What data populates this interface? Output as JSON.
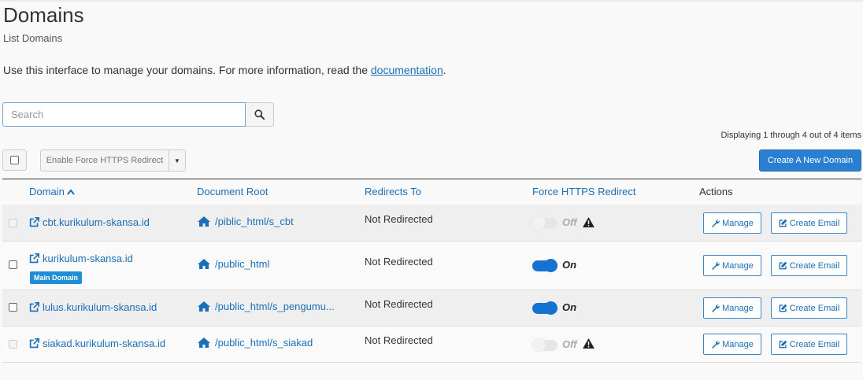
{
  "page": {
    "title": "Domains",
    "subtitle": "List Domains",
    "intro_text": "Use this interface to manage your domains. For more information, read the ",
    "intro_link": "documentation",
    "intro_end": "."
  },
  "search": {
    "placeholder": "Search",
    "value": ""
  },
  "toolbar": {
    "display_count": "Displaying 1 through 4 out of 4 items",
    "bulk_action_label": "Enable Force HTTPS Redirect",
    "create_label": "Create A New Domain"
  },
  "table": {
    "headers": {
      "domain": "Domain",
      "doc_root": "Document Root",
      "redirects": "Redirects To",
      "force_https": "Force HTTPS Redirect",
      "actions": "Actions"
    },
    "rows": [
      {
        "domain": "cbt.kurikulum-skansa.id",
        "doc_root": "/piblic_html/s_cbt",
        "redirects": "Not Redirected",
        "https_state": "Off",
        "badge": "",
        "manage": "Manage",
        "create_email": "Create Email"
      },
      {
        "domain": "kurikulum-skansa.id",
        "doc_root": "/public_html",
        "redirects": "Not Redirected",
        "https_state": "On",
        "badge": "Main Domain",
        "manage": "Manage",
        "create_email": "Create Email"
      },
      {
        "domain": "lulus.kurikulum-skansa.id",
        "doc_root": "/public_html/s_pengumu...",
        "redirects": "Not Redirected",
        "https_state": "On",
        "badge": "",
        "manage": "Manage",
        "create_email": "Create Email"
      },
      {
        "domain": "siakad.kurikulum-skansa.id",
        "doc_root": "/public_html/s_siakad",
        "redirects": "Not Redirected",
        "https_state": "Off",
        "badge": "",
        "manage": "Manage",
        "create_email": "Create Email"
      }
    ]
  },
  "colors": {
    "accent": "#1b6fb7",
    "primary_button": "#2a7fd0",
    "toggle_on": "#1572d1",
    "badge": "#1e8fd6"
  },
  "icons": [
    "search-icon",
    "external-link-icon",
    "home-icon",
    "warning-icon",
    "wrench-icon",
    "edit-icon",
    "caret-down-icon",
    "sort-up-icon"
  ]
}
